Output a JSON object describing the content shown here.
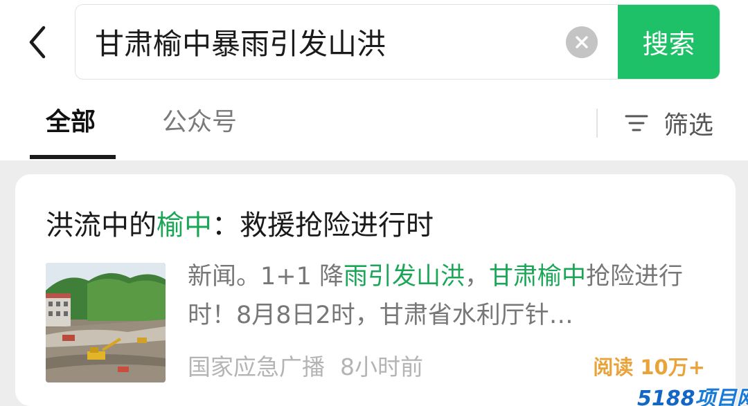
{
  "search": {
    "query": "甘肃榆中暴雨引发山洪",
    "button_label": "搜索"
  },
  "tabs": [
    {
      "label": "全部",
      "active": true
    },
    {
      "label": "公众号",
      "active": false
    }
  ],
  "filter": {
    "label": "筛选"
  },
  "result": {
    "title_segments": [
      {
        "text": "洪流中的",
        "highlight": false
      },
      {
        "text": "榆中",
        "highlight": true
      },
      {
        "text": "：救援抢险进行时",
        "highlight": false
      }
    ],
    "snippet_segments": [
      {
        "text": "新闻。1+1 降",
        "highlight": false
      },
      {
        "text": "雨引发山洪",
        "highlight": true
      },
      {
        "text": "，",
        "highlight": false
      },
      {
        "text": "甘肃榆中",
        "highlight": true
      },
      {
        "text": "抢险进行时！8月8日2时，甘肃省水利厅针…",
        "highlight": false
      }
    ],
    "source": "国家应急广播",
    "time": "8小时前",
    "reads_label": "阅读",
    "reads_count": "10万+"
  },
  "watermark": {
    "num": "5188",
    "text": "项目网"
  },
  "colors": {
    "accent_green": "#1ec167",
    "highlight_green": "#1ba657",
    "reads_orange": "#e8a33b",
    "page_bg": "#ededed"
  },
  "icons": [
    "back-arrow-icon",
    "clear-icon",
    "filter-icon"
  ]
}
